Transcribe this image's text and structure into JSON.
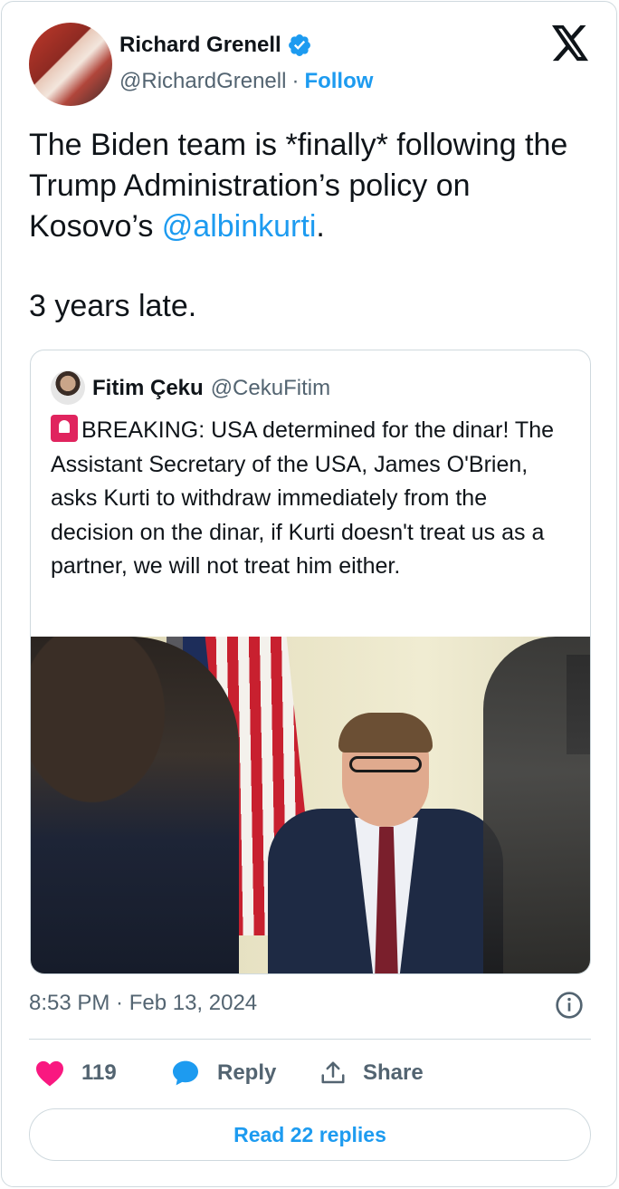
{
  "author": {
    "name": "Richard Grenell",
    "handle": "@RichardGrenell",
    "separator": "·",
    "follow_label": "Follow",
    "verified": true
  },
  "tweet": {
    "line1_prefix": "The Biden team is *finally* following the Trump Administration’s policy on Kosovo’s ",
    "mention": "@albinkurti",
    "line1_suffix": ".",
    "line2": "3 years late."
  },
  "quoted": {
    "name": "Fitim Çeku",
    "handle": "@CekuFitim",
    "text": "BREAKING: USA determined for the dinar! The Assistant Secretary of the USA, James O'Brien, asks Kurti to withdraw immediately from the decision on the dinar, if Kurti doesn't treat us as a partner, we will not treat him either.",
    "emoji_icon": "police-siren-icon"
  },
  "meta": {
    "timestamp": "8:53 PM · Feb 13, 2024"
  },
  "actions": {
    "like_count": "119",
    "reply_label": "Reply",
    "share_label": "Share"
  },
  "read_replies_label": "Read 22 replies",
  "colors": {
    "accent": "#1d9bf0",
    "like": "#f91880",
    "text": "#0f1419",
    "muted": "#536471",
    "border": "#cfd9de"
  }
}
